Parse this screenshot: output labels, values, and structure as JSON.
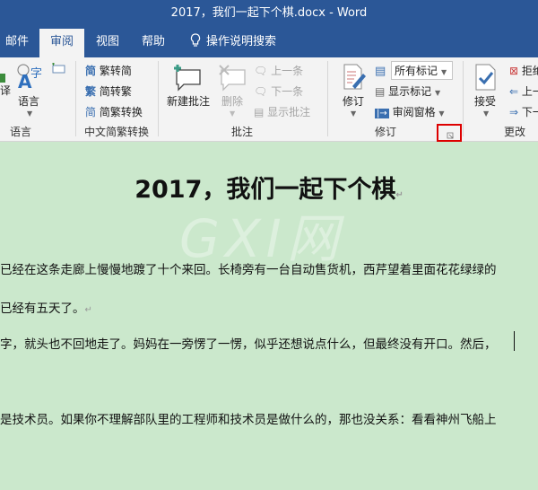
{
  "window": {
    "title": "2017，我们一起下个棋.docx  -  Word"
  },
  "tabs": [
    {
      "label": "邮件",
      "active": false
    },
    {
      "label": "审阅",
      "active": true
    },
    {
      "label": "视图",
      "active": false
    },
    {
      "label": "帮助",
      "active": false
    }
  ],
  "tell_me": {
    "label": "操作说明搜索",
    "icon": "lightbulb-icon"
  },
  "ribbon": {
    "language_group": {
      "language_label": "语言",
      "group_label": "语言"
    },
    "chinese_conversion_group": {
      "items": [
        "繁转简",
        "简转繁",
        "简繁转换"
      ],
      "group_label": "中文简繁转换"
    },
    "comments_group": {
      "new_comment": "新建批注",
      "delete": "删除",
      "previous": "上一条",
      "next": "下一条",
      "show_comments": "显示批注",
      "group_label": "批注"
    },
    "tracking_group": {
      "track_changes": "修订",
      "markup_dropdown": "所有标记",
      "show_markup": "显示标记",
      "reviewing_pane": "审阅窗格",
      "group_label": "修订"
    },
    "changes_group": {
      "accept": "接受",
      "reject": "拒绝",
      "previous": "上一条",
      "next": "下一条",
      "group_label": "更改"
    }
  },
  "document": {
    "title": "2017，我们一起下个棋",
    "watermark": "GXI网",
    "paragraphs": [
      "已经在这条走廊上慢慢地踱了十个来回。长椅旁有一台自动售货机，西芹望着里面花花绿绿的",
      "已经有五天了。",
      "字，就头也不回地走了。妈妈在一旁愣了一愣，似乎还想说点什么，但最终没有开口。然后，",
      "是技术员。如果你不理解部队里的工程师和技术员是做什么的，那也没关系：看看神州飞船上"
    ],
    "paragraph_mark": "↵"
  },
  "colors": {
    "title_bar": "#2b5797",
    "document_bg": "#cbe8cc",
    "highlight": "#dd0000"
  }
}
